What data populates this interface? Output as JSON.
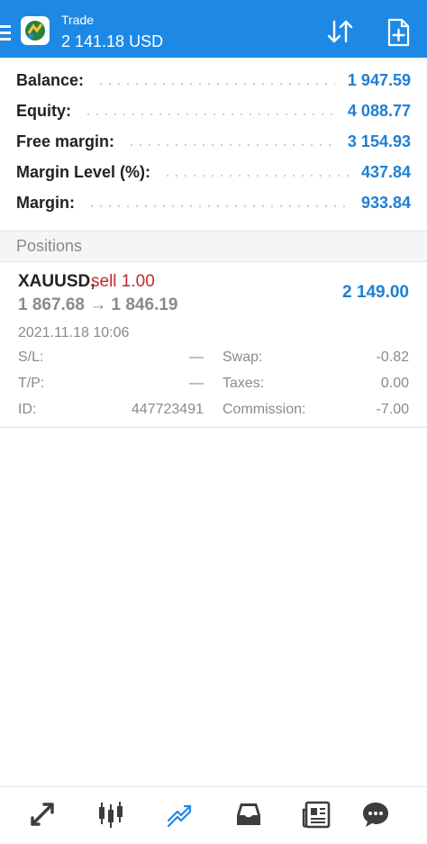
{
  "header": {
    "title": "Trade",
    "balance": "2 141.18 USD",
    "accent_color": "#1e88e5"
  },
  "summary": [
    {
      "label": "Balance:",
      "value": "1 947.59"
    },
    {
      "label": "Equity:",
      "value": "4 088.77"
    },
    {
      "label": "Free margin:",
      "value": "3 154.93"
    },
    {
      "label": "Margin Level (%):",
      "value": "437.84"
    },
    {
      "label": "Margin:",
      "value": "933.84"
    }
  ],
  "positions_section": {
    "title": "Positions"
  },
  "position": {
    "symbol": "XAUUSD,",
    "type": "sell 1.00",
    "prices": "1 867.68 → 1 846.19",
    "profit": "2 149.00",
    "time": "2021.11.18 10:06",
    "sl_label": "S/L:",
    "sl_value": "—",
    "tp_label": "T/P:",
    "tp_value": "—",
    "id_label": "ID:",
    "id_value": "447723491",
    "swap_label": "Swap:",
    "swap_value": "-0.82",
    "taxes_label": "Taxes:",
    "taxes_value": "0.00",
    "commission_label": "Commission:",
    "commission_value": "-7.00"
  },
  "bottom_nav": [
    {
      "icon": "quotes-icon"
    },
    {
      "icon": "chart-icon"
    },
    {
      "icon": "trade-icon",
      "active": true
    },
    {
      "icon": "history-icon"
    },
    {
      "icon": "news-icon"
    },
    {
      "icon": "messages-icon"
    }
  ]
}
